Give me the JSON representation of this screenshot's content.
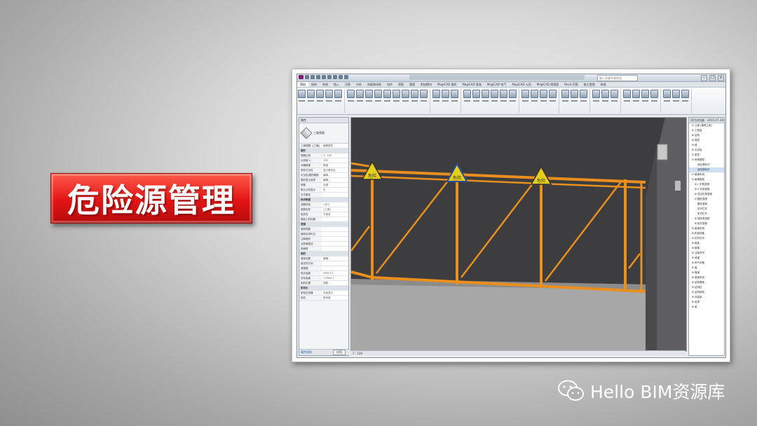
{
  "banner": {
    "title": "危险源管理"
  },
  "watermark": {
    "text": "Hello BIM资源库",
    "icon": "wechat-icon"
  },
  "app": {
    "search_placeholder": "键入关键字或短语",
    "tabs": [
      "建筑",
      "结构",
      "系统",
      "插入",
      "注释",
      "分析",
      "体量和场地",
      "协作",
      "视图",
      "管理",
      "附加模块",
      "MagiCAD 通风",
      "MagiCAD 管道",
      "MagiCAD 电气",
      "MagiCAD 公用",
      "MagiCAD 原理图",
      "Revit 识图",
      "施工管理",
      "修改"
    ],
    "active_tab": "建筑",
    "properties": {
      "header": "属性",
      "type_name": "三维视图",
      "view_selector": "三维视图: {三维}",
      "edit_type": "编辑类型",
      "rows": [
        {
          "k": "图形",
          "v": "",
          "sec": true
        },
        {
          "k": "视图比例",
          "v": "1 : 100"
        },
        {
          "k": "比例值 1:",
          "v": "100"
        },
        {
          "k": "详细程度",
          "v": "精细"
        },
        {
          "k": "零件可见性",
          "v": "显示原状态"
        },
        {
          "k": "可见性/图形替换",
          "v": "编辑..."
        },
        {
          "k": "图形显示选项",
          "v": "编辑..."
        },
        {
          "k": "规程",
          "v": "协调"
        },
        {
          "k": "默认分析显示",
          "v": "无"
        },
        {
          "k": "日光路径",
          "v": ""
        },
        {
          "k": "标识数据",
          "v": "",
          "sec": true
        },
        {
          "k": "视图样板",
          "v": "<无>"
        },
        {
          "k": "视图名称",
          "v": "{三维}"
        },
        {
          "k": "相关性",
          "v": "不相关"
        },
        {
          "k": "图纸上的标题",
          "v": ""
        },
        {
          "k": "范围",
          "v": "",
          "sec": true
        },
        {
          "k": "裁剪视图",
          "v": ""
        },
        {
          "k": "裁剪区域可见",
          "v": ""
        },
        {
          "k": "注释裁剪",
          "v": ""
        },
        {
          "k": "远剪裁激活",
          "v": ""
        },
        {
          "k": "剖面框",
          "v": ""
        },
        {
          "k": "相机",
          "v": "",
          "sec": true
        },
        {
          "k": "渲染设置",
          "v": "编辑..."
        },
        {
          "k": "锁定的方向",
          "v": ""
        },
        {
          "k": "透视图",
          "v": ""
        },
        {
          "k": "视点高度",
          "v": "39913.2"
        },
        {
          "k": "目标高度",
          "v": "-17844.7"
        },
        {
          "k": "相机位置",
          "v": "调整"
        },
        {
          "k": "阶段化",
          "v": "",
          "sec": true
        },
        {
          "k": "阶段过滤器",
          "v": "全部显示"
        },
        {
          "k": "相位",
          "v": "新构造"
        }
      ],
      "footer": "属性帮助",
      "apply": "应用"
    },
    "viewport": {
      "scale": "1 : 100",
      "sign_label": "危险"
    },
    "browser": {
      "header": "项目浏览器 - 2015.07.28-西安中...",
      "items": [
        {
          "t": "⊟ 立面 (建筑立面)",
          "d": 1
        },
        {
          "t": "⊟ 工程量",
          "d": 1
        },
        {
          "t": "⊞ 结构",
          "d": 1
        },
        {
          "t": "⊞ 楼层",
          "d": 1
        },
        {
          "t": "⊞ 墙",
          "d": 1
        },
        {
          "t": "⊞ 天花板",
          "d": 1
        },
        {
          "t": "⊟ 屋顶",
          "d": 1
        },
        {
          "t": "⊟ 常规模型",
          "d": 1
        },
        {
          "t": "危险源标识",
          "d": 3
        },
        {
          "t": "危险源标识",
          "d": 3,
          "sel": true
        },
        {
          "t": "⊟ 幕墙系统",
          "d": 1
        },
        {
          "t": "⊟ 幕墙嵌板",
          "d": 1
        },
        {
          "t": "⊞ L 形角竖梃",
          "d": 2
        },
        {
          "t": "⊞ V 形角竖梃",
          "d": 2
        },
        {
          "t": "⊞ 四边形角竖梃",
          "d": 2
        },
        {
          "t": "⊟ 圆形竖梃",
          "d": 2
        },
        {
          "t": "圆形竖梃",
          "d": 3
        },
        {
          "t": "防护栏杆",
          "d": 3
        },
        {
          "t": "防护栏杆",
          "d": 3
        },
        {
          "t": "⊞ 梯形角竖梃",
          "d": 2
        },
        {
          "t": "⊞ 矩形竖梃",
          "d": 2
        },
        {
          "t": "⊞ 幕墙系统",
          "d": 1
        },
        {
          "t": "⊞ 机械设备",
          "d": 1
        },
        {
          "t": "⊞ 栏杆扶手",
          "d": 1
        },
        {
          "t": "⊞ 楼板",
          "d": 1
        },
        {
          "t": "⊞ 楼梯",
          "d": 1
        },
        {
          "t": "⊞ 注释符号",
          "d": 1
        },
        {
          "t": "⊞ 坡道",
          "d": 1
        },
        {
          "t": "⊞ 电气设备",
          "d": 1
        },
        {
          "t": "⊞ 窗",
          "d": 1
        },
        {
          "t": "⊞ 管道",
          "d": 1
        },
        {
          "t": "⊞ 管道系统",
          "d": 1
        },
        {
          "t": "⊞ 结构基础",
          "d": 1
        },
        {
          "t": "⊞ 结构柱",
          "d": 1
        },
        {
          "t": "⊞ 结构框架",
          "d": 1
        },
        {
          "t": "⊞ 体量族",
          "d": 1
        },
        {
          "t": "⊞ 轮廓",
          "d": 1
        },
        {
          "t": "⊞ 组",
          "d": 1
        }
      ]
    }
  }
}
